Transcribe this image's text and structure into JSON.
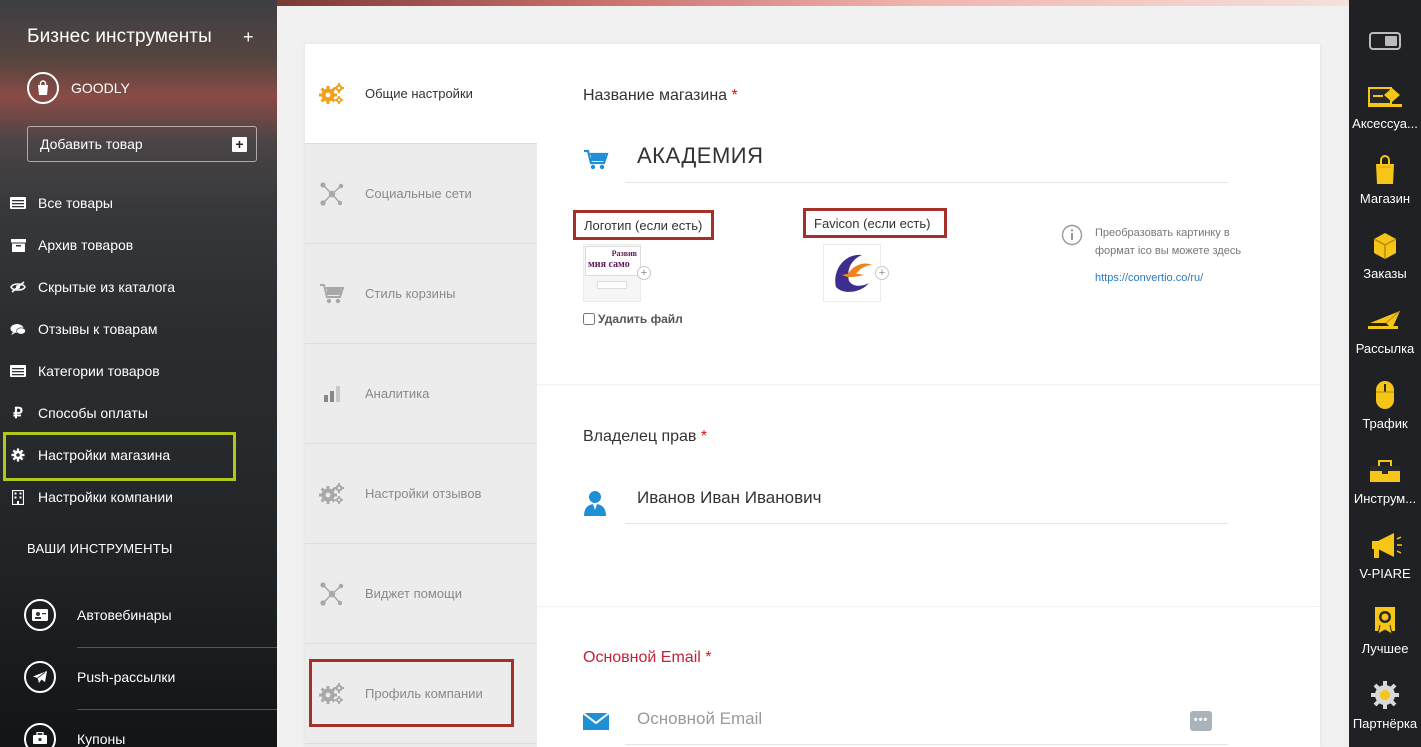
{
  "sidebar": {
    "title": "Бизнес инструменты",
    "add_symbol": "+",
    "shop_name": "GOODLY",
    "add_product": "Добавить товар",
    "nav": [
      {
        "label": "Все товары",
        "icon": "list-icon"
      },
      {
        "label": "Архив товаров",
        "icon": "archive-icon"
      },
      {
        "label": "Скрытые из каталога",
        "icon": "hidden-eye-icon"
      },
      {
        "label": "Отзывы к товарам",
        "icon": "chat-icon"
      },
      {
        "label": "Категории товаров",
        "icon": "list-icon"
      },
      {
        "label": "Способы оплаты",
        "icon": "ruble-icon"
      },
      {
        "label": "Настройки магазина",
        "icon": "gear-icon"
      },
      {
        "label": "Настройки компании",
        "icon": "building-icon"
      }
    ],
    "section_title": "ВАШИ ИНСТРУМЕНТЫ",
    "tools": [
      {
        "label": "Автовебинары",
        "icon": "webinar-icon"
      },
      {
        "label": "Push-рассылки",
        "icon": "paper-plane-icon"
      },
      {
        "label": "Купоны",
        "icon": "coupon-icon"
      }
    ],
    "highlight_color": "#b2c71c"
  },
  "tabs": [
    {
      "label": "Общие настройки",
      "icon": "gears-icon",
      "active": true
    },
    {
      "label": "Социальные сети",
      "icon": "share-icon"
    },
    {
      "label": "Стиль корзины",
      "icon": "cart-icon"
    },
    {
      "label": "Аналитика",
      "icon": "bars-icon"
    },
    {
      "label": "Настройки отзывов",
      "icon": "gears-icon"
    },
    {
      "label": "Виджет помощи",
      "icon": "share-icon"
    },
    {
      "label": "Профиль компании",
      "icon": "gears-icon"
    }
  ],
  "form": {
    "shop_name_label": "Название магазина",
    "required_mark": "*",
    "shop_name_value": "АКАДЕМИЯ",
    "logo_label": "Логотип (если есть)",
    "logo_text_line1": "Развив",
    "logo_text_line2": "мия само",
    "favicon_label": "Favicon (если есть)",
    "delete_file": "Удалить файл",
    "info_text": "Преобразовать картинку в формат ico вы можете здесь",
    "info_link": "https://convertio.co/ru/",
    "owner_label": "Владелец прав",
    "owner_value": "Иванов Иван Иванович",
    "email_label": "Основной Email",
    "email_placeholder": "Основной Email",
    "more_dots": "•••"
  },
  "right_bar": [
    {
      "label": "Аксессуа...",
      "icon": "accessories-icon"
    },
    {
      "label": "Магазин",
      "icon": "shopping-bag-icon"
    },
    {
      "label": "Заказы",
      "icon": "orders-icon"
    },
    {
      "label": "Рассылка",
      "icon": "mail-plane-icon"
    },
    {
      "label": "Трафик",
      "icon": "mouse-icon"
    },
    {
      "label": "Инструм...",
      "icon": "toolbox-icon"
    },
    {
      "label": "V-PIARE",
      "icon": "megaphone-icon"
    },
    {
      "label": "Лучшее",
      "icon": "award-icon"
    },
    {
      "label": "Партнёрка",
      "icon": "partner-gear-icon"
    }
  ],
  "colors": {
    "accent_blue": "#1f8fd6",
    "required_red": "#d0191d",
    "outline_red": "#a4302a",
    "gear_orange": "#f0a01c"
  }
}
